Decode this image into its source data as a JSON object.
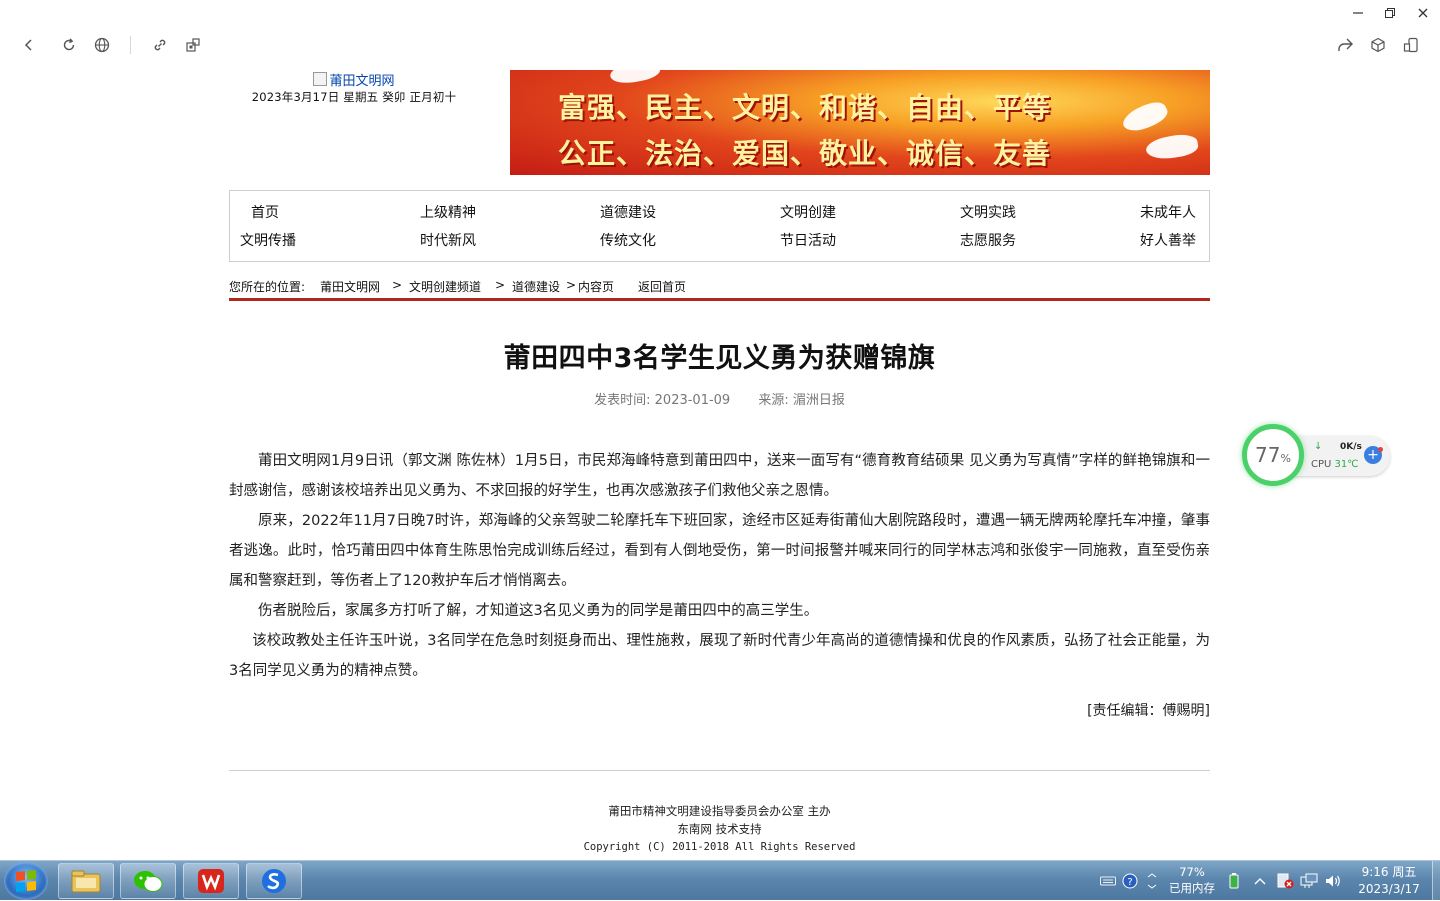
{
  "browser": {
    "toolbar_left": [
      "back-icon",
      "refresh-icon",
      "globe-icon",
      "link-icon",
      "qr-icon"
    ],
    "toolbar_right": [
      "share-icon",
      "cube-icon",
      "phone-icon"
    ],
    "window_controls": [
      "minimize-icon",
      "restore-icon",
      "close-icon"
    ]
  },
  "header": {
    "logo_alt": "莆田文明网",
    "date": "2023年3月17日 星期五 癸卯 正月初十",
    "banner_line1": "富强、民主、文明、和谐、自由、平等",
    "banner_line2": "公正、法治、爱国、敬业、诚信、友善"
  },
  "nav": {
    "row1": [
      "首页",
      "上级精神",
      "道德建设",
      "文明创建",
      "文明实践",
      "未成年人"
    ],
    "row2": [
      "文明传播",
      "时代新风",
      "传统文化",
      "节日活动",
      "志愿服务",
      "好人善举"
    ]
  },
  "breadcrumb": {
    "label": "您所在的位置:",
    "items": [
      "莆田文明网",
      "文明创建频道",
      "道德建设",
      "内容页"
    ],
    "separator": ">",
    "back_home": "返回首页"
  },
  "article": {
    "title": "莆田四中3名学生见义勇为获赠锦旗",
    "publish_time": "发表时间: 2023-01-09",
    "source": "来源: 湄洲日报",
    "paragraphs": [
      "莆田文明网1月9日讯（郭文渊 陈佐林）1月5日，市民郑海峰特意到莆田四中，送来一面写有“德育教育结硕果 见义勇为写真情”字样的鲜艳锦旗和一封感谢信，感谢该校培养出见义勇为、不求回报的好学生，也再次感激孩子们救他父亲之恩情。",
      "原来，2022年11月7日晚7时许，郑海峰的父亲驾驶二轮摩托车下班回家，途经市区延寿街莆仙大剧院路段时，遭遇一辆无牌两轮摩托车冲撞，肇事者逃逸。此时，恰巧莆田四中体育生陈思怡完成训练后经过，看到有人倒地受伤，第一时间报警并喊来同行的同学林志鸿和张俊宇一同施救，直至受伤亲属和警察赶到，等伤者上了120救护车后才悄悄离去。",
      "伤者脱险后，家属多方打听了解，才知道这3名见义勇为的同学是莆田四中的高三学生。",
      "该校政教处主任许玉叶说，3名同学在危急时刻挺身而出、理性施救，展现了新时代青少年高尚的道德情操和优良的作风素质，弘扬了社会正能量，为3名同学见义勇为的精神点赞。"
    ],
    "editor": "[责任编辑：傅赐明]"
  },
  "footer": {
    "line1": "莆田市精神文明建设指导委员会办公室 主办",
    "line2": "东南网 技术支持",
    "line3": "Copyright (C) 2011-2018 All Rights Reserved"
  },
  "monitor": {
    "percent": "77",
    "percent_unit": "%",
    "net_speed": "0K/s",
    "cpu_label": "CPU",
    "cpu_temp": "31℃"
  },
  "taskbar": {
    "apps": [
      "file-explorer-icon",
      "wechat-icon",
      "wps-icon",
      "sogou-browser-icon"
    ],
    "memory_percent": "77%",
    "memory_label": "已用内存",
    "time": "9:16 周五",
    "date": "2023/3/17"
  }
}
